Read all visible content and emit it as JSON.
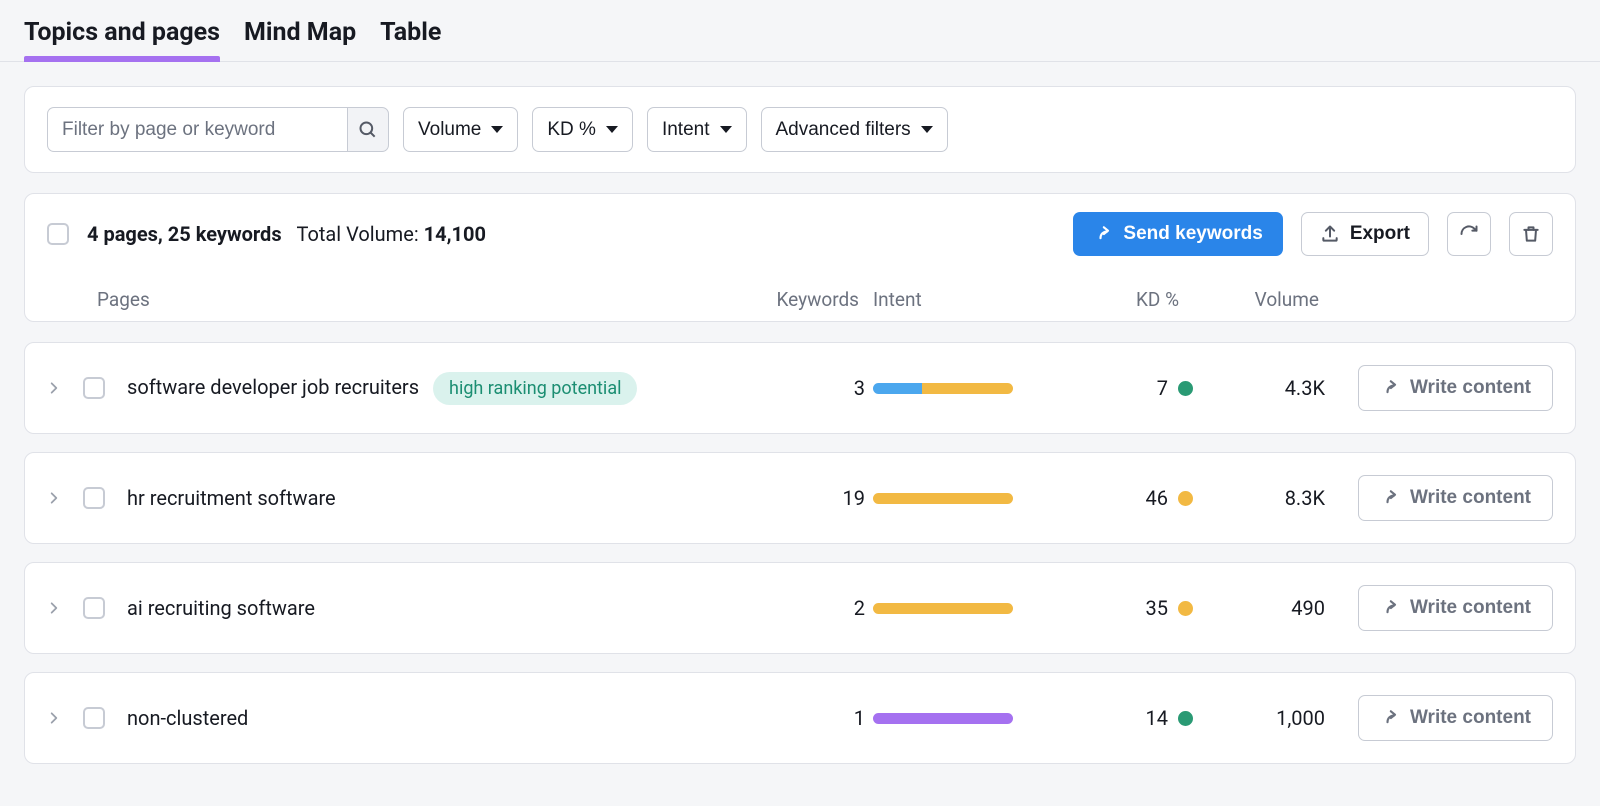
{
  "tabs": [
    {
      "label": "Topics and pages",
      "active": true
    },
    {
      "label": "Mind Map",
      "active": false
    },
    {
      "label": "Table",
      "active": false
    }
  ],
  "filters": {
    "placeholder": "Filter by page or keyword",
    "volume": "Volume",
    "kd": "KD %",
    "intent": "Intent",
    "advanced": "Advanced filters"
  },
  "summary": {
    "counts": "4 pages, 25 keywords",
    "total_label": "Total Volume:",
    "total_value": "14,100"
  },
  "actions": {
    "send": "Send keywords",
    "export": "Export"
  },
  "columns": {
    "pages": "Pages",
    "keywords": "Keywords",
    "intent": "Intent",
    "kd": "KD %",
    "volume": "Volume"
  },
  "rows": [
    {
      "name": "software developer job recruiters",
      "badge": "high ranking potential",
      "keywords": "3",
      "intent_segments": [
        {
          "color": "#4ba7ee",
          "pct": 35
        },
        {
          "color": "#f2b943",
          "pct": 65
        }
      ],
      "kd": "7",
      "kd_color": "#2a9a74",
      "volume": "4.3K",
      "write": "Write content"
    },
    {
      "name": "hr recruitment software",
      "badge": "",
      "keywords": "19",
      "intent_segments": [
        {
          "color": "#f2b943",
          "pct": 100
        }
      ],
      "kd": "46",
      "kd_color": "#f2b943",
      "volume": "8.3K",
      "write": "Write content"
    },
    {
      "name": "ai recruiting software",
      "badge": "",
      "keywords": "2",
      "intent_segments": [
        {
          "color": "#f2b943",
          "pct": 100
        }
      ],
      "kd": "35",
      "kd_color": "#f2b943",
      "volume": "490",
      "write": "Write content"
    },
    {
      "name": "non-clustered",
      "badge": "",
      "keywords": "1",
      "intent_segments": [
        {
          "color": "#a571f0",
          "pct": 100
        }
      ],
      "kd": "14",
      "kd_color": "#2a9a74",
      "volume": "1,000",
      "write": "Write content"
    }
  ]
}
